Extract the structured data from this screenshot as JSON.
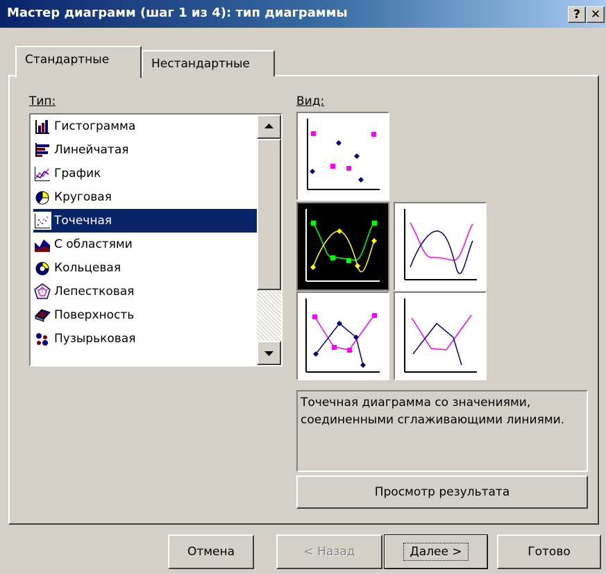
{
  "window": {
    "title": "Мастер диаграмм (шаг 1 из 4): тип диаграммы",
    "help_label": "?",
    "close_label": "✕"
  },
  "tabs": [
    {
      "label": "Стандартные",
      "active": true
    },
    {
      "label": "Нестандартные",
      "active": false
    }
  ],
  "type_section": {
    "label": "Тип:",
    "items": [
      {
        "label": "Гистограмма",
        "icon": "column-chart-icon"
      },
      {
        "label": "Линейчатая",
        "icon": "bar-chart-icon"
      },
      {
        "label": "График",
        "icon": "line-chart-icon"
      },
      {
        "label": "Круговая",
        "icon": "pie-chart-icon"
      },
      {
        "label": "Точечная",
        "icon": "scatter-chart-icon",
        "selected": true
      },
      {
        "label": "С областями",
        "icon": "area-chart-icon"
      },
      {
        "label": "Кольцевая",
        "icon": "doughnut-chart-icon"
      },
      {
        "label": "Лепестковая",
        "icon": "radar-chart-icon"
      },
      {
        "label": "Поверхность",
        "icon": "surface-chart-icon"
      },
      {
        "label": "Пузырьковая",
        "icon": "bubble-chart-icon"
      }
    ]
  },
  "subtype_section": {
    "label": "Вид:",
    "subtypes": [
      {
        "name": "scatter-markers-only",
        "selected": false
      },
      {
        "name": "scatter-smoothed-lines-markers",
        "selected": true
      },
      {
        "name": "scatter-smoothed-lines",
        "selected": false
      },
      {
        "name": "scatter-straight-lines-markers",
        "selected": false
      },
      {
        "name": "scatter-straight-lines",
        "selected": false
      }
    ],
    "description": "Точечная диаграмма со значениями, соединенными сглаживающими линиями.",
    "preview_button": "Просмотр результата"
  },
  "footer": {
    "cancel": "Отмена",
    "back": "< Назад",
    "next": "Далее >",
    "finish": "Готово"
  },
  "colors": {
    "title_bar_start": "#0a246a",
    "title_bar_end": "#a6caf0",
    "selection": "#0a246a",
    "face": "#d4d0c8",
    "series_pink": "#ff00ff",
    "series_navy": "#000080"
  }
}
